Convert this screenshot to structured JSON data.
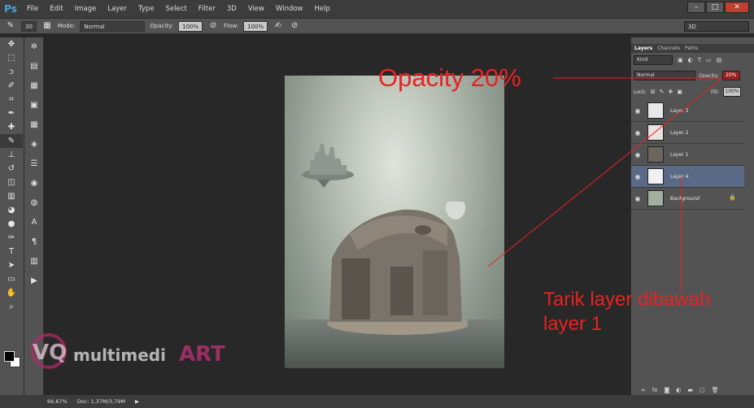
{
  "app": {
    "logo": "Ps",
    "menu": [
      "File",
      "Edit",
      "Image",
      "Layer",
      "Type",
      "Select",
      "Filter",
      "3D",
      "View",
      "Window",
      "Help"
    ],
    "window_controls": [
      "–",
      "□",
      "✕"
    ]
  },
  "options_bar": {
    "brush_size": "30",
    "mode_label": "Mode:",
    "mode_value": "Normal",
    "opacity_label": "Opacity:",
    "opacity_value": "100%",
    "flow_label": "Flow:",
    "flow_value": "100%",
    "workspace": "3D"
  },
  "layers_panel": {
    "tabs": [
      "Layers",
      "Channels",
      "Paths"
    ],
    "kind_label": "Kind",
    "blend_mode": "Normal",
    "opacity_label": "Opacity:",
    "opacity_value": "20%",
    "lock_label": "Lock:",
    "fill_label": "Fill:",
    "fill_value": "100%",
    "layers": [
      {
        "name": "Layer 3",
        "selected": false
      },
      {
        "name": "Layer 2",
        "selected": false
      },
      {
        "name": "Layer 1",
        "selected": false
      },
      {
        "name": "Layer 4",
        "selected": true
      },
      {
        "name": "Background",
        "selected": false,
        "locked": true
      }
    ]
  },
  "status_bar": {
    "zoom": "66,67%",
    "doc": "Doc: 1,37M/3,79M"
  },
  "annotations": {
    "opacity_note": "Opacity 20%",
    "drag_note_line1": "Tarik layer dibawah",
    "drag_note_line2": "layer 1"
  },
  "watermark": {
    "text": "VQ multimediART"
  },
  "colors": {
    "annotation": "#e82222",
    "selected_layer": "#5a6a86",
    "opacity_highlight": "#9b2020"
  }
}
